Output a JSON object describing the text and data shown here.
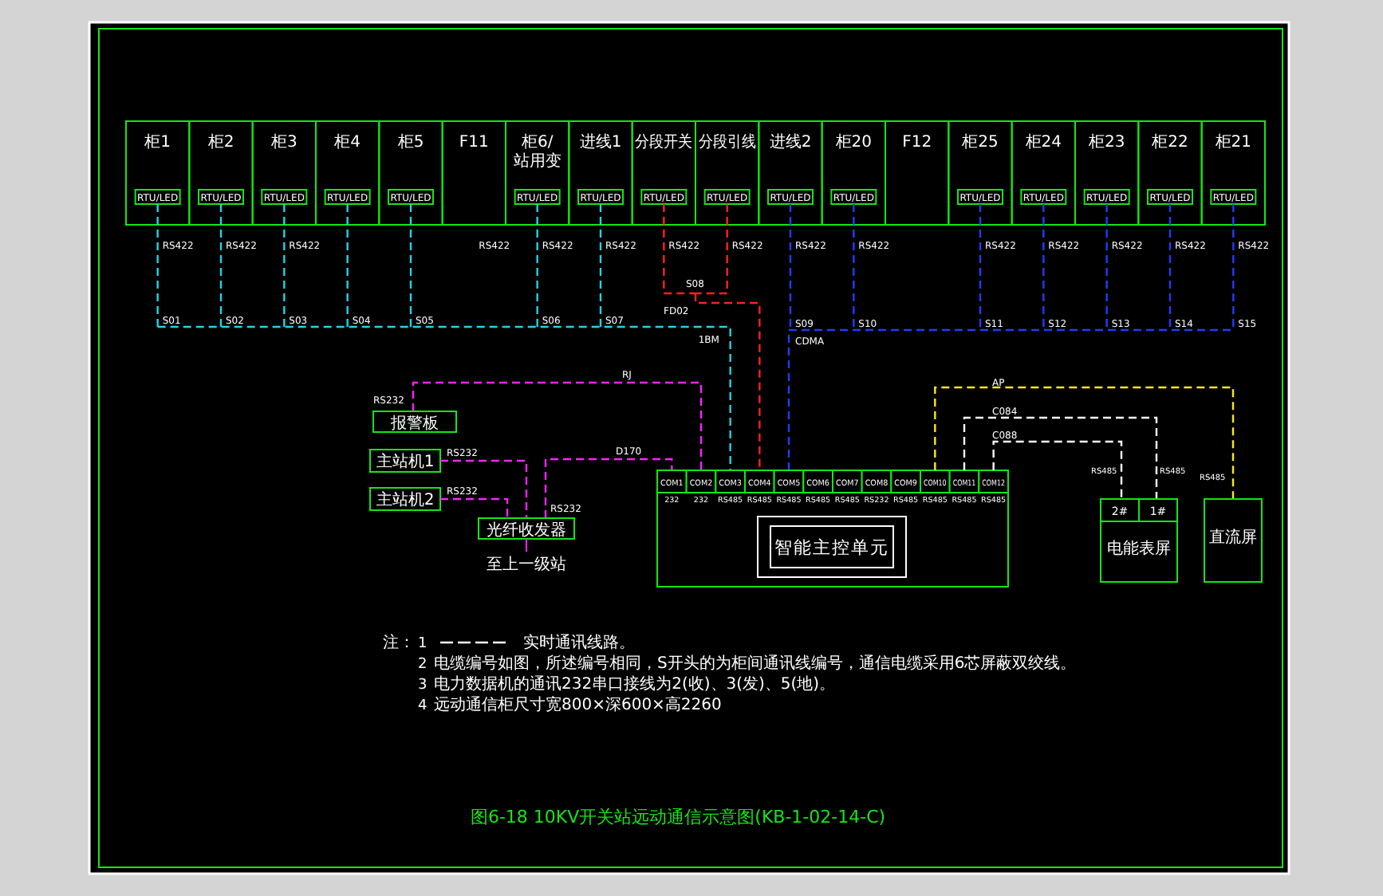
{
  "cabinets": [
    {
      "label": "柜1",
      "module": "RTU/LED",
      "port": "RS422",
      "tag": "S01",
      "color": "#22d3e6"
    },
    {
      "label": "柜2",
      "module": "RTU/LED",
      "port": "RS422",
      "tag": "S02",
      "color": "#22d3e6"
    },
    {
      "label": "柜3",
      "module": "RTU/LED",
      "port": "RS422",
      "tag": "S03",
      "color": "#22d3e6"
    },
    {
      "label": "柜4",
      "module": "RTU/LED",
      "tag": "S04",
      "color": "#22d3e6"
    },
    {
      "label": "柜5",
      "module": "RTU/LED",
      "tag": "S05",
      "color": "#22d3e6"
    },
    {
      "label": "F11",
      "port": "RS422"
    },
    {
      "label": "柜6/",
      "label_2": "站用变",
      "module": "RTU/LED",
      "port": "RS422",
      "tag": "S06",
      "color": "#22d3e6"
    },
    {
      "label": "进线1",
      "module": "RTU/LED",
      "port": "RS422",
      "tag": "S07",
      "color": "#22d3e6"
    },
    {
      "label": "分段开关",
      "module": "RTU/LED",
      "port": "RS422",
      "color": "#ff2020"
    },
    {
      "label": "分段引线",
      "module": "RTU/LED",
      "port": "RS422",
      "color": "#ff2020"
    },
    {
      "label": "进线2",
      "module": "RTU/LED",
      "port": "RS422",
      "tag": "S09",
      "color": "#1f3dff"
    },
    {
      "label": "柜20",
      "module": "RTU/LED",
      "port": "RS422",
      "tag": "S10",
      "color": "#1f3dff"
    },
    {
      "label": "F12"
    },
    {
      "label": "柜25",
      "module": "RTU/LED",
      "port": "RS422",
      "tag": "S11",
      "color": "#1f3dff"
    },
    {
      "label": "柜24",
      "module": "RTU/LED",
      "port": "RS422",
      "tag": "S12",
      "color": "#1f3dff"
    },
    {
      "label": "柜23",
      "module": "RTU/LED",
      "port": "RS422",
      "tag": "S13",
      "color": "#1f3dff"
    },
    {
      "label": "柜22",
      "module": "RTU/LED",
      "port": "RS422",
      "tag": "S14",
      "color": "#1f3dff"
    },
    {
      "label": "柜21",
      "module": "RTU/LED",
      "port": "RS422",
      "tag": "S15",
      "color": "#1f3dff"
    }
  ],
  "buses": {
    "left": {
      "color": "#22d3e6",
      "label": "1BM"
    },
    "section": {
      "color": "#ff2020",
      "tag": "S08",
      "label": "FD02"
    },
    "right": {
      "color": "#1f3dff",
      "label": "CDMA"
    }
  },
  "alarm_panel": {
    "label": "报警板",
    "port": "RS232",
    "cable": "RJ"
  },
  "master_stations": [
    {
      "label": "主站机1",
      "port": "RS232"
    },
    {
      "label": "主站机2",
      "port": "RS232"
    }
  ],
  "fiber_transceiver": {
    "label": "光纤收发器",
    "port": "RS232",
    "cable": "D170",
    "destination": "至上一级站"
  },
  "controller": {
    "title": "智能主控单元",
    "ports": [
      {
        "name": "COM1",
        "protocol": "232"
      },
      {
        "name": "COM2",
        "protocol": "232"
      },
      {
        "name": "COM3",
        "protocol": "RS485"
      },
      {
        "name": "COM4",
        "protocol": "RS485"
      },
      {
        "name": "COM5",
        "protocol": "RS485"
      },
      {
        "name": "COM6",
        "protocol": "RS485"
      },
      {
        "name": "COM7",
        "protocol": "RS485"
      },
      {
        "name": "COM8",
        "protocol": "RS232"
      },
      {
        "name": "COM9",
        "protocol": "RS485"
      },
      {
        "name": "COM10",
        "protocol": "RS485"
      },
      {
        "name": "COM11",
        "protocol": "RS485"
      },
      {
        "name": "COM12",
        "protocol": "RS485"
      }
    ]
  },
  "meter_panel": {
    "label": "电能表屏",
    "meters": [
      "2#",
      "1#"
    ],
    "cables": [
      {
        "label": "C084",
        "port": "RS485"
      },
      {
        "label": "C088",
        "port": "RS485"
      }
    ]
  },
  "dc_panel": {
    "label": "直流屏",
    "cable": "AP",
    "port": "RS485"
  },
  "notes": {
    "heading": "注：",
    "items": [
      {
        "kind": "legend",
        "number": "1",
        "text": "实时通讯线路。"
      },
      {
        "kind": "text",
        "number": "2",
        "text": "电缆编号如图，所述编号相同，S开头的为柜间通讯线编号，通信电缆采用6芯屏蔽双绞线。"
      },
      {
        "kind": "text",
        "number": "3",
        "text": "电力数据机的通讯232串口接线为2(收)、3(发)、5(地)。"
      },
      {
        "kind": "text",
        "number": "4",
        "text": "远动通信柜尺寸宽800×深600×高2260"
      }
    ]
  },
  "title": "图6-18 10KV开关站远动通信示意图(KB-1-02-14-C)"
}
